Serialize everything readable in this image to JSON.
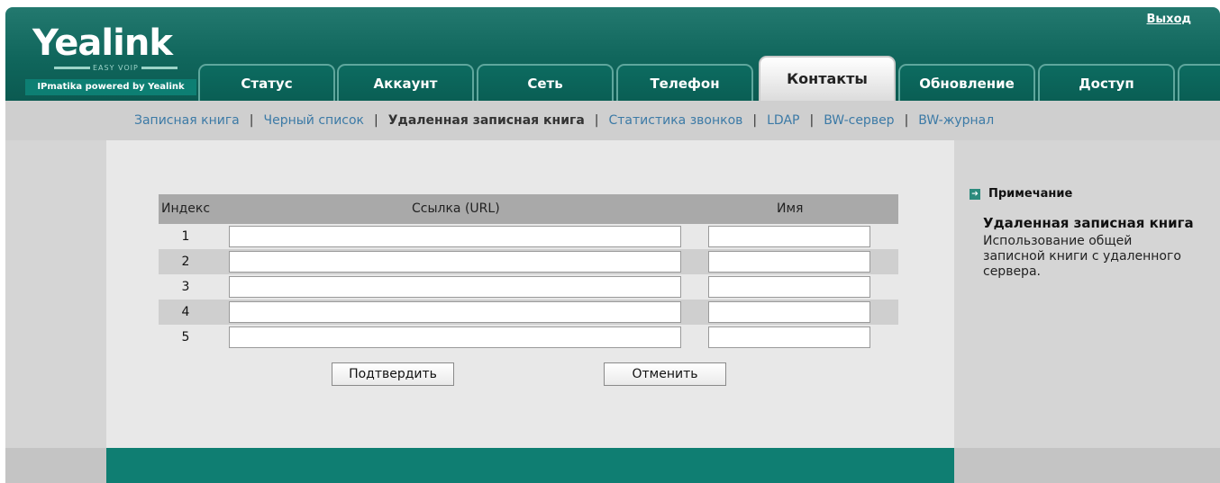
{
  "header": {
    "logo": "Yealink",
    "logo_sub": "EASY VOIP",
    "logo_strip": "IPmatika powered by Yealink",
    "logout": "Выход"
  },
  "tabs": [
    {
      "label": "Статус"
    },
    {
      "label": "Аккаунт"
    },
    {
      "label": "Сеть"
    },
    {
      "label": "Телефон"
    },
    {
      "label": "Контакты",
      "active": true
    },
    {
      "label": "Обновление"
    },
    {
      "label": "Доступ"
    }
  ],
  "submenu": [
    {
      "label": "Записная книга"
    },
    {
      "label": "Черный список"
    },
    {
      "label": "Удаленная записная книга",
      "active": true
    },
    {
      "label": "Статистика звонков"
    },
    {
      "label": "LDAP"
    },
    {
      "label": "BW-сервер"
    },
    {
      "label": "BW-журнал"
    }
  ],
  "table": {
    "headers": {
      "index": "Индекс",
      "url": "Ссылка (URL)",
      "name": "Имя"
    },
    "rows": [
      {
        "index": "1",
        "url": "",
        "name": ""
      },
      {
        "index": "2",
        "url": "",
        "name": ""
      },
      {
        "index": "3",
        "url": "",
        "name": ""
      },
      {
        "index": "4",
        "url": "",
        "name": ""
      },
      {
        "index": "5",
        "url": "",
        "name": ""
      }
    ]
  },
  "buttons": {
    "confirm": "Подтвердить",
    "cancel": "Отменить"
  },
  "note": {
    "heading": "Примечание",
    "title": "Удаленная записная книга",
    "text": "Использование общей записной книги с удаленного сервера."
  },
  "colors": {
    "header": "#10665c",
    "footer": "#0f7e72",
    "link": "#3c7aa6"
  }
}
